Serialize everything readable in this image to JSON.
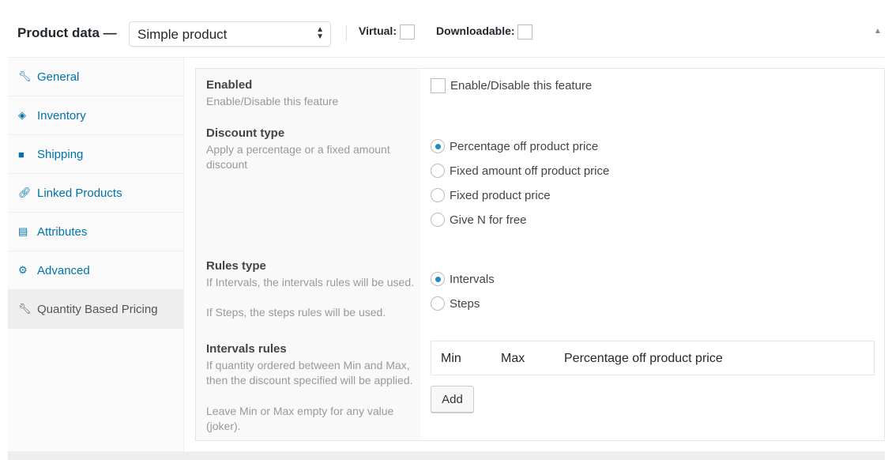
{
  "header": {
    "title": "Product data —",
    "product_type": "Simple product",
    "virtual_label": "Virtual:",
    "virtual_checked": false,
    "downloadable_label": "Downloadable:",
    "downloadable_checked": false
  },
  "sidebar": {
    "items": [
      {
        "label": "General",
        "icon": "wrench-icon"
      },
      {
        "label": "Inventory",
        "icon": "tag-icon"
      },
      {
        "label": "Shipping",
        "icon": "truck-icon"
      },
      {
        "label": "Linked Products",
        "icon": "link-icon"
      },
      {
        "label": "Attributes",
        "icon": "list-icon"
      },
      {
        "label": "Advanced",
        "icon": "gear-icon"
      },
      {
        "label": "Quantity Based Pricing",
        "icon": "wrench-icon",
        "active": true
      }
    ]
  },
  "fields": {
    "enabled": {
      "label": "Enabled",
      "desc": "Enable/Disable this feature",
      "option": "Enable/Disable this feature",
      "checked": false
    },
    "discount_type": {
      "label": "Discount type",
      "desc": "Apply a percentage or a fixed amount discount",
      "options": [
        "Percentage off product price",
        "Fixed amount off product price",
        "Fixed product price",
        "Give N for free"
      ],
      "selected": "Percentage off product price"
    },
    "rules_type": {
      "label": "Rules type",
      "desc1": "If Intervals, the intervals rules will be used.",
      "desc2": "If Steps, the steps rules will be used.",
      "options": [
        "Intervals",
        "Steps"
      ],
      "selected": "Intervals"
    },
    "intervals_rules": {
      "label": "Intervals rules",
      "desc1": "If quantity ordered between Min and Max, then the discount specified will be applied.",
      "desc2": "Leave Min or Max empty for any value (joker).",
      "columns": [
        "Min",
        "Max",
        "Percentage off product price"
      ],
      "add_label": "Add"
    }
  },
  "colors": {
    "link": "#0073aa",
    "radio_checked": "#1e8cbe"
  }
}
